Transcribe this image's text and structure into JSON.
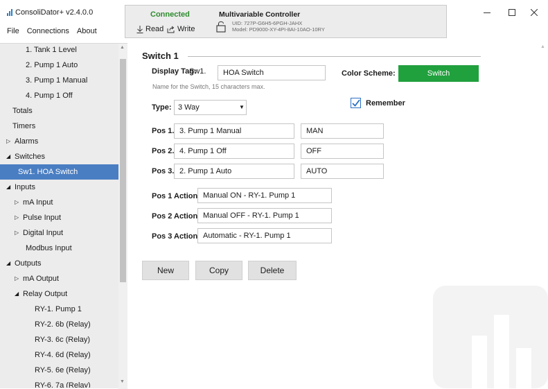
{
  "app": {
    "title": "ConsoliDator+ v2.4.0.0"
  },
  "menu": [
    "File",
    "Connections",
    "About"
  ],
  "connection": {
    "status": "Connected",
    "read_label": "Read",
    "write_label": "Write",
    "controller_title": "Multivariable Controller",
    "uid": "UID: 727P-G6H5-6PGH-JAHX",
    "model": "Model: PD9000-XY-4PI-8AI-10AO-10RY"
  },
  "sidebar": {
    "items": [
      {
        "label": "1. Tank 1 Level"
      },
      {
        "label": "2. Pump 1 Auto"
      },
      {
        "label": "3. Pump 1 Manual"
      },
      {
        "label": "4. Pump 1 Off"
      },
      {
        "label": "Totals"
      },
      {
        "label": "Timers"
      },
      {
        "label": "Alarms"
      },
      {
        "label": "Switches"
      },
      {
        "label": "Sw1. HOA Switch"
      },
      {
        "label": "Inputs"
      },
      {
        "label": "mA Input"
      },
      {
        "label": "Pulse Input"
      },
      {
        "label": "Digital Input"
      },
      {
        "label": "Modbus Input"
      },
      {
        "label": "Outputs"
      },
      {
        "label": "mA Output"
      },
      {
        "label": "Relay Output"
      },
      {
        "label": "RY-1. Pump 1"
      },
      {
        "label": "RY-2. 6b (Relay)"
      },
      {
        "label": "RY-3. 6c (Relay)"
      },
      {
        "label": "RY-4. 6d (Relay)"
      },
      {
        "label": "RY-5. 6e (Relay)"
      },
      {
        "label": "RY-6. 7a (Relay)"
      }
    ]
  },
  "switch_form": {
    "group_title": "Switch 1",
    "display_tag_label": "Display Tag:",
    "display_tag_prefix": "Sw1.",
    "display_tag_value": "HOA Switch",
    "display_tag_hint": "Name for the Switch, 15 characters max.",
    "color_scheme_label": "Color Scheme:",
    "color_scheme_value": "Switch",
    "color_scheme_color": "#21a03e",
    "type_label": "Type:",
    "type_value": "3 Way",
    "remember_label": "Remember",
    "remember_checked": true,
    "positions": [
      {
        "label": "Pos 1.",
        "name": "3. Pump 1 Manual",
        "short": "MAN"
      },
      {
        "label": "Pos 2.",
        "name": "4. Pump 1 Off",
        "short": "OFF"
      },
      {
        "label": "Pos 3.",
        "name": "2. Pump 1 Auto",
        "short": "AUTO"
      }
    ],
    "actions": [
      {
        "label": "Pos 1 Action:",
        "value": "Manual ON - RY-1. Pump 1"
      },
      {
        "label": "Pos 2 Action:",
        "value": "Manual OFF - RY-1. Pump 1"
      },
      {
        "label": "Pos 3 Action:",
        "value": "Automatic - RY-1. Pump 1"
      }
    ]
  },
  "buttons": {
    "new": "New",
    "copy": "Copy",
    "delete": "Delete"
  },
  "colors": {
    "accent": "#4a7ec2",
    "connected": "#2e8b2e",
    "sidebar_bg": "#ececec"
  }
}
